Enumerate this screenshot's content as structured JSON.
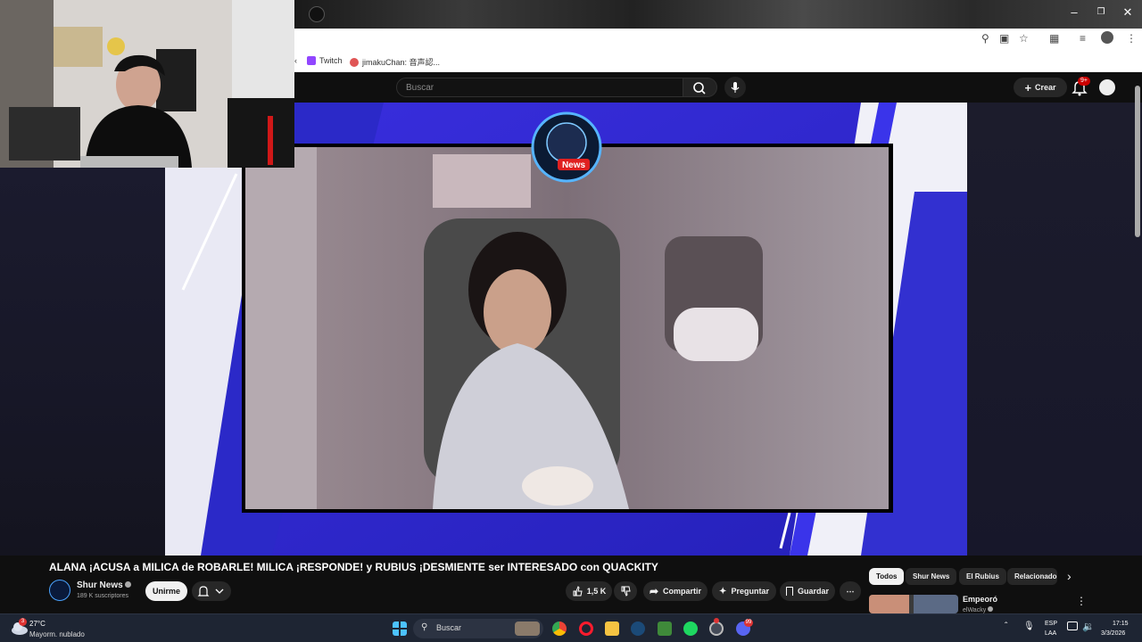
{
  "bookmarks": [
    {
      "label": "Twitch",
      "color": "#9146ff"
    },
    {
      "label": "jimakuChan: 音声認...",
      "color": "#e05555"
    }
  ],
  "youtube": {
    "search_placeholder": "Buscar",
    "create_label": "Crear",
    "notification_badge": "9+"
  },
  "video": {
    "overlay_logo_text": "News",
    "title": "ALANA ¡ACUSA a MILICA de ROBARLE! MILICA ¡RESPONDE! y RUBIUS ¡DESMIENTE ser INTERESADO con QUACKITY",
    "channel_name": "Shur News",
    "subscribers": "189 K suscriptores",
    "join_label": "Unirme",
    "likes": "1,5 K",
    "share_label": "Compartir",
    "ask_label": "Preguntar",
    "save_label": "Guardar"
  },
  "chips": [
    "Todos",
    "Shur News",
    "El Rubius",
    "Relacionado"
  ],
  "recommendation": {
    "title": "Empeoró",
    "channel": "elWacky"
  },
  "taskbar": {
    "weather_temp": "27°C",
    "weather_desc": "Mayorm. nublado",
    "weather_badge": "3",
    "search_label": "Buscar",
    "lang_top": "ESP",
    "lang_bottom": "LAA",
    "time": "17:15",
    "date": "3/3/2026",
    "discord_badge": "99"
  }
}
